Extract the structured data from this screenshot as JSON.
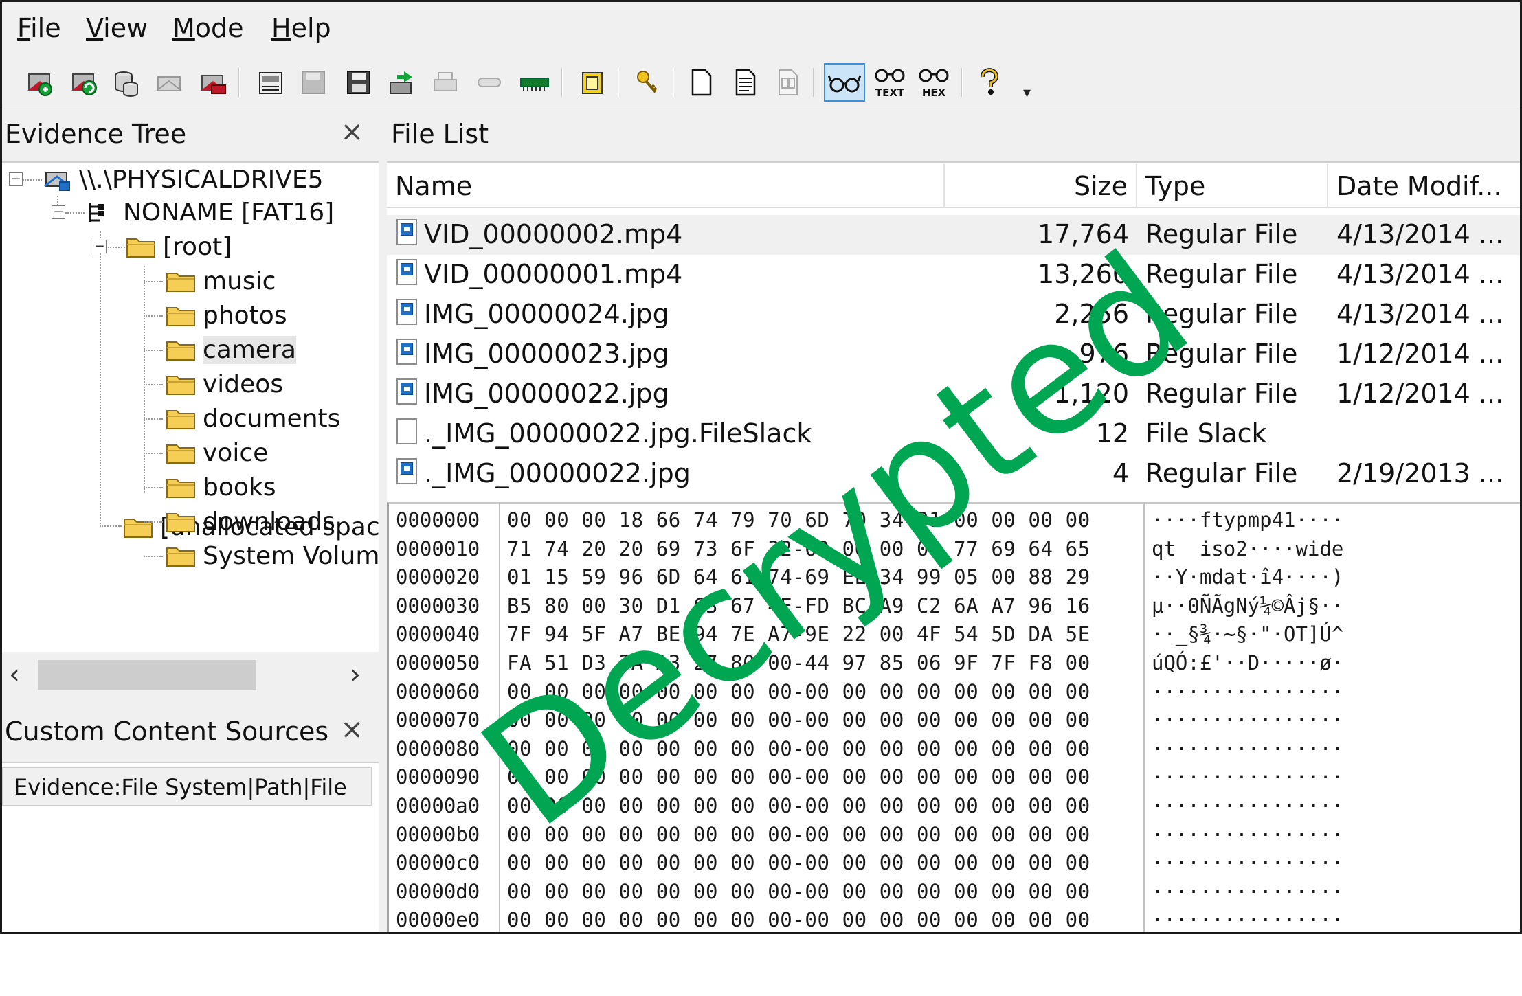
{
  "menu": [
    "File",
    "View",
    "Mode",
    "Help"
  ],
  "toolbar": {
    "buttons": [
      "add-evidence-icon",
      "refresh-evidence-icon",
      "database-icon",
      "remove-evidence-icon",
      "close-evidence-icon",
      "report-icon",
      "save-icon",
      "save-as-icon",
      "export-icon",
      "print-icon",
      "link-icon",
      "memory-icon",
      "bookmark-icon",
      "key-icon",
      "new-document-icon",
      "document-icon",
      "compare-icon",
      "viewer-glasses-icon",
      "text-view-icon",
      "hex-view-icon",
      "help-icon"
    ],
    "text_label": "TEXT",
    "hex_label": "HEX",
    "active": "viewer-glasses-icon"
  },
  "evidence_tree": {
    "title": "Evidence Tree",
    "close": "×",
    "drive": "\\\\.\\PHYSICALDRIVE5",
    "volume": "NONAME [FAT16]",
    "root": "[root]",
    "folders": [
      "music",
      "photos",
      "camera",
      "videos",
      "documents",
      "voice",
      "books",
      "downloads",
      "System Volume"
    ],
    "unallocated": "[unallocated space",
    "selected": "camera"
  },
  "custom_sources": {
    "title": "Custom Content Sources",
    "close": "×",
    "column": "Evidence:File System|Path|File"
  },
  "file_list": {
    "title": "File List",
    "columns": [
      "Name",
      "Size",
      "Type",
      "Date Modif..."
    ],
    "rows": [
      {
        "name": "VID_00000002.mp4",
        "size": "17,764",
        "type": "Regular File",
        "date": "4/13/2014 ...",
        "icon": "image"
      },
      {
        "name": "VID_00000001.mp4",
        "size": "13,260",
        "type": "Regular File",
        "date": "4/13/2014 ...",
        "icon": "image"
      },
      {
        "name": "IMG_00000024.jpg",
        "size": "2,256",
        "type": "Regular File",
        "date": "4/13/2014 ...",
        "icon": "image"
      },
      {
        "name": "IMG_00000023.jpg",
        "size": "976",
        "type": "Regular File",
        "date": "1/12/2014 ...",
        "icon": "image"
      },
      {
        "name": "IMG_00000022.jpg",
        "size": "1,120",
        "type": "Regular File",
        "date": "1/12/2014 ...",
        "icon": "image"
      },
      {
        "name": "._IMG_00000022.jpg.FileSlack",
        "size": "12",
        "type": "File Slack",
        "date": "",
        "icon": "blank"
      },
      {
        "name": "._IMG_00000022.jpg",
        "size": "4",
        "type": "Regular File",
        "date": "2/19/2013 ...",
        "icon": "image"
      }
    ]
  },
  "hex": {
    "offsets": [
      "0000000",
      "0000010",
      "0000020",
      "0000030",
      "0000040",
      "0000050",
      "0000060",
      "0000070",
      "0000080",
      "0000090",
      "00000a0",
      "00000b0",
      "00000c0",
      "00000d0",
      "00000e0"
    ],
    "bytes": [
      "00 00 00 18 66 74 79 70 6D 70 34 31 00 00 00 00",
      "71 74 20 20 69 73 6F 32-00 00 00 08 77 69 64 65",
      "01 15 59 96 6D 64 61 74-69 EE 34 99 05 00 88 29",
      "B5 80 00 30 D1 C3 67 4E-FD BC A9 C2 6A A7 96 16",
      "7F 94 5F A7 BE 94 7E A7-9E 22 00 4F 54 5D DA 5E",
      "FA 51 D3 3A A3 27 80 00-44 97 85 06 9F 7F F8 00",
      "00 00 00 00 00 00 00 00-00 00 00 00 00 00 00 00",
      "00 00 00 00 00 00 00 00-00 00 00 00 00 00 00 00",
      "00 00 00 00 00 00 00 00-00 00 00 00 00 00 00 00",
      "00 00 00 00 00 00 00 00-00 00 00 00 00 00 00 00",
      "00 00 00 00 00 00 00 00-00 00 00 00 00 00 00 00",
      "00 00 00 00 00 00 00 00-00 00 00 00 00 00 00 00",
      "00 00 00 00 00 00 00 00-00 00 00 00 00 00 00 00",
      "00 00 00 00 00 00 00 00-00 00 00 00 00 00 00 00",
      "00 00 00 00 00 00 00 00-00 00 00 00 00 00 00 00"
    ],
    "ascii": [
      "····ftypmp41····",
      "qt  iso2····wide",
      "··Y·mdat·î4····)",
      "µ··0ÑÃgNý¼©Âj§··",
      "··_§¾·~§·\"·OT]Ú^",
      "úQÓ:£'··D·····ø·",
      "················",
      "················",
      "················",
      "················",
      "················",
      "················",
      "················",
      "················",
      "················"
    ]
  },
  "watermark": "Decrypted",
  "colors": {
    "watermark": "#00a651",
    "selection": "#cce4f7",
    "folder": "#f5cf55"
  }
}
